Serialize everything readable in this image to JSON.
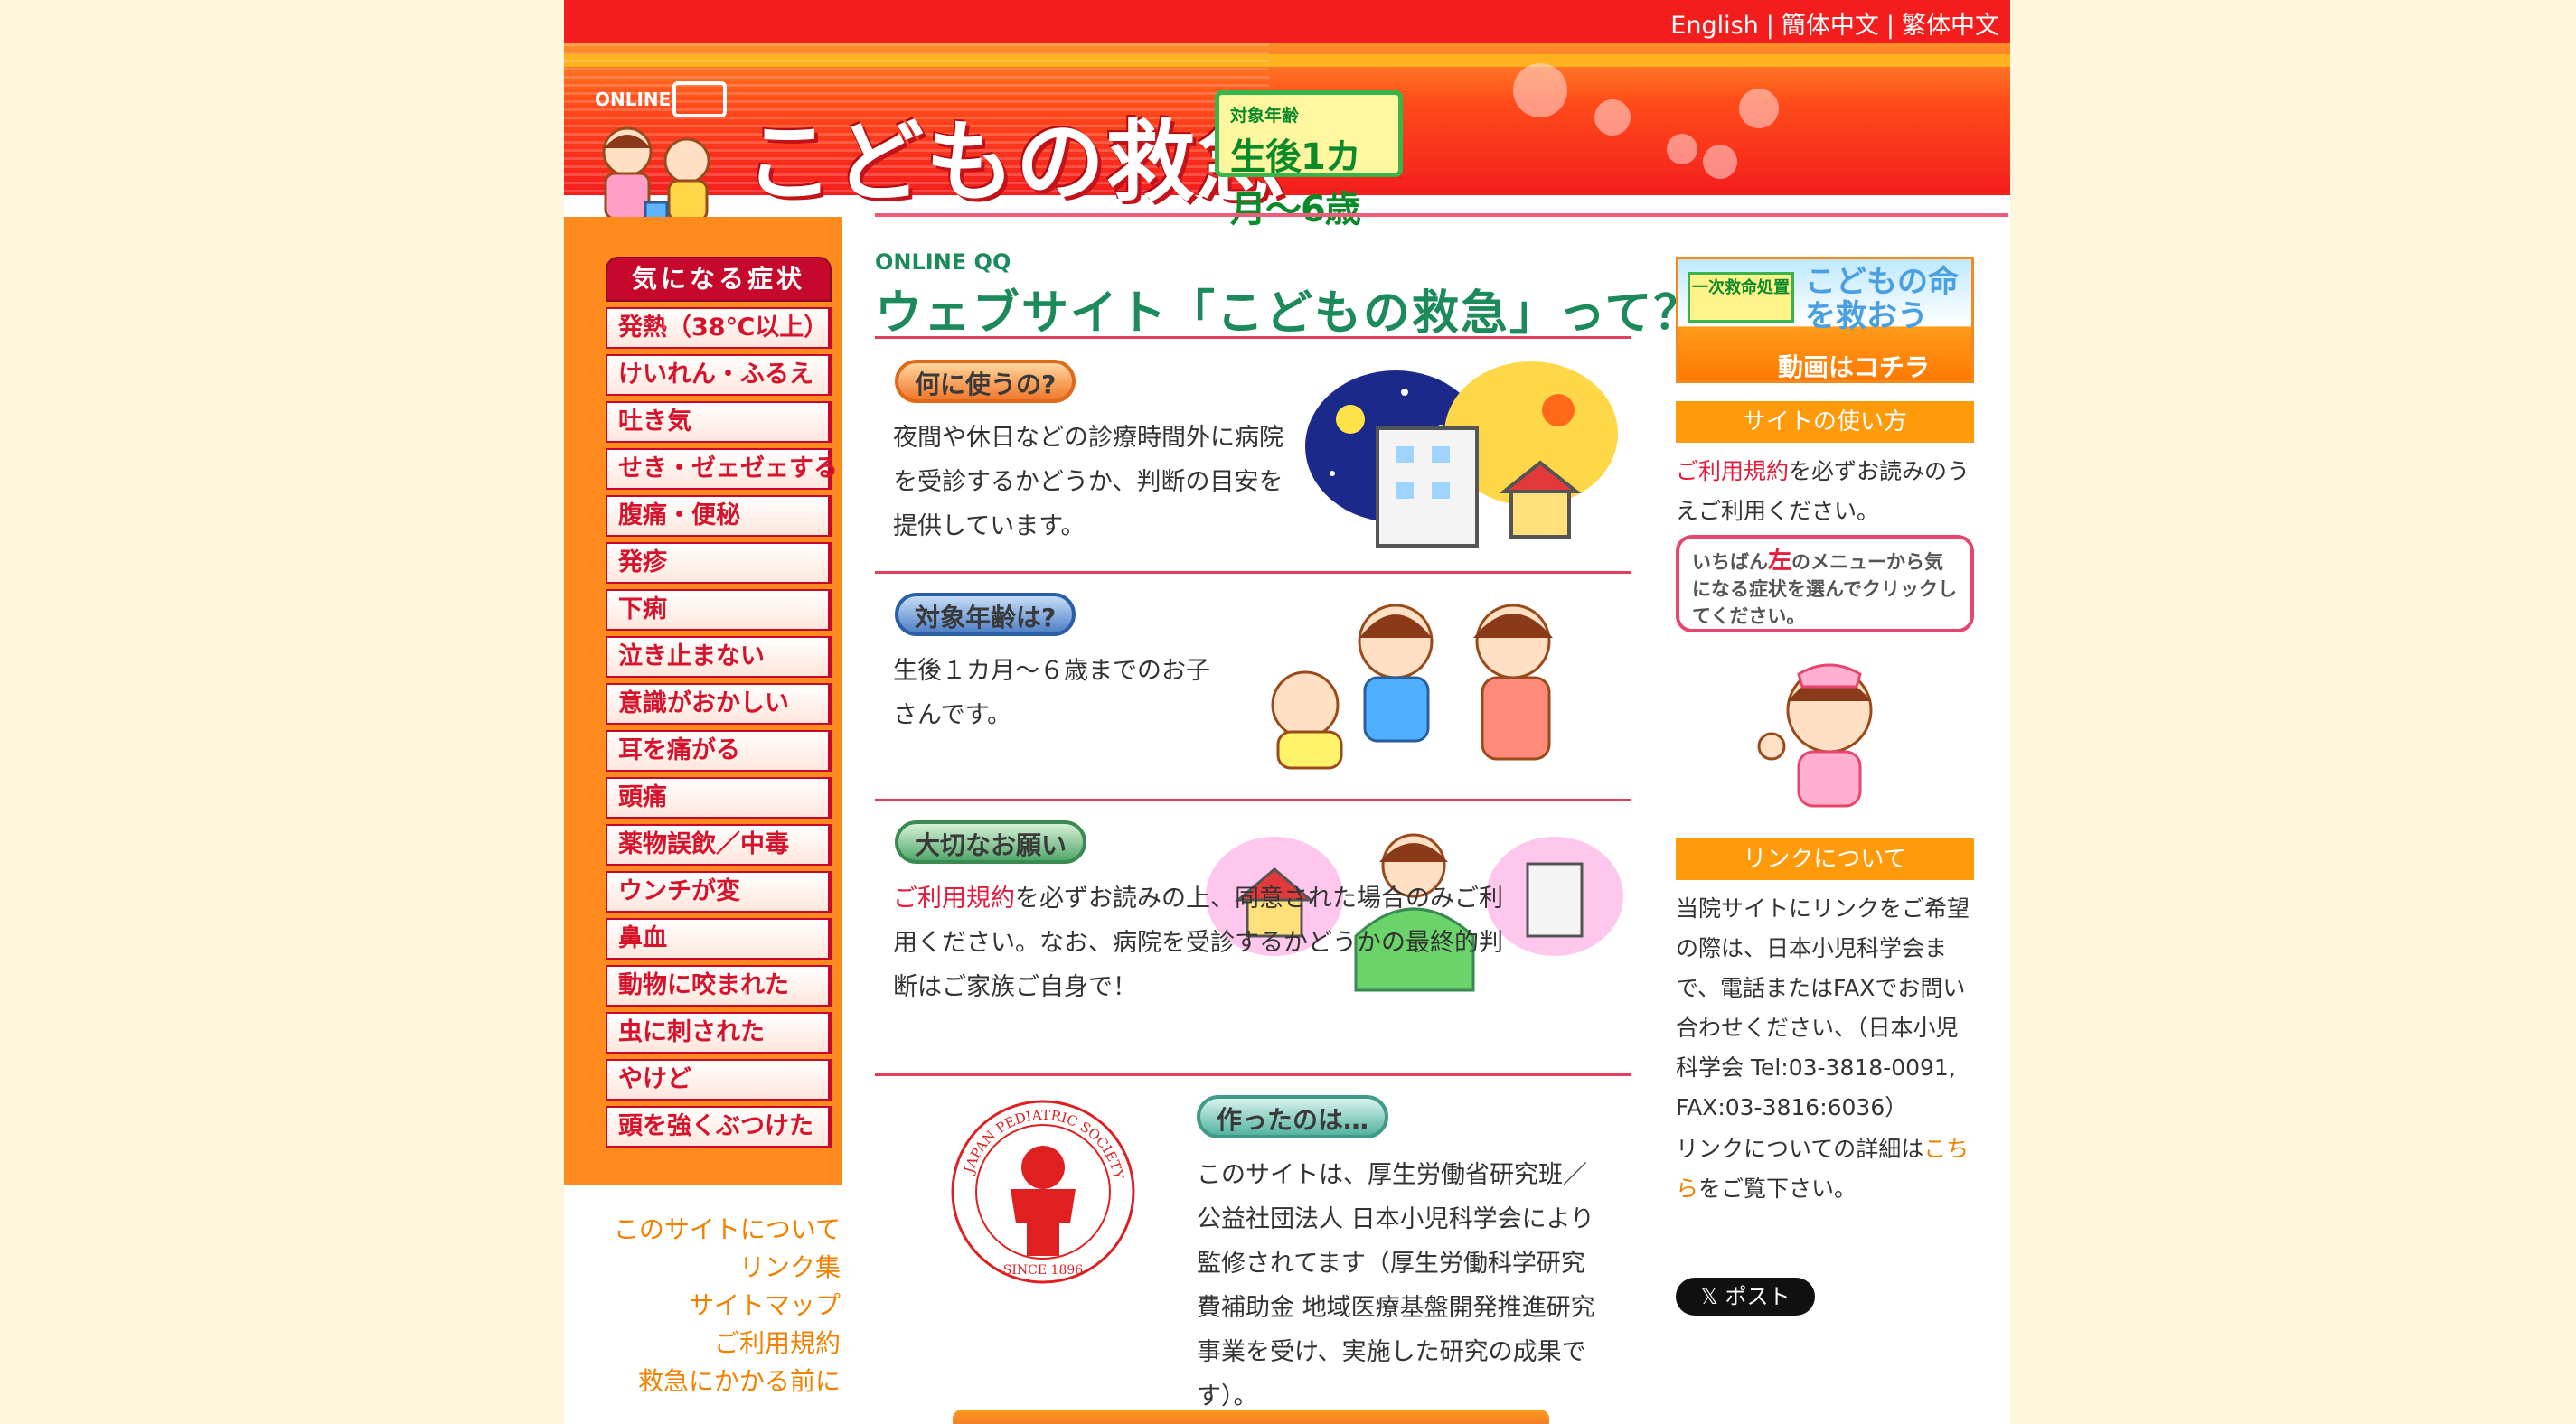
{
  "languages": [
    "English",
    "簡体中文",
    "繁体中文"
  ],
  "header": {
    "logo_online": "ONLINE",
    "site_title": "こどもの救急",
    "age_label": "対象年齢",
    "age_range": "生後1カ月〜6歳"
  },
  "symptoms": {
    "heading": "気になる症状",
    "items": [
      "発熱（38℃以上）",
      "けいれん・ふるえ",
      "吐き気",
      "せき・ゼェゼェする",
      "腹痛・便秘",
      "発疹",
      "下痢",
      "泣き止まない",
      "意識がおかしい",
      "耳を痛がる",
      "頭痛",
      "薬物誤飲／中毒",
      "ウンチが変",
      "鼻血",
      "動物に咬まれた",
      "虫に刺された",
      "やけど",
      "頭を強くぶつけた"
    ]
  },
  "footer_links": [
    "このサイトについて",
    "リンク集",
    "サイトマップ",
    "ご利用規約",
    "救急にかかる前に"
  ],
  "main": {
    "qq_label": "ONLINE QQ",
    "title": "ウェブサイト「こどもの救急」って？",
    "sections": [
      {
        "heading": "何に使うの?",
        "text": "夜間や休日などの診療時間外に病院を受診するかどうか、判断の目安を提供しています。"
      },
      {
        "heading": "対象年齢は?",
        "text": "生後１カ月〜６歳までのお子さんです。"
      },
      {
        "heading": "大切なお願い",
        "link": "ご利用規約",
        "text": "を必ずお読みの上、同意された場合のみご利用ください。なお、病院を受診するかどうかの最終的判断はご家族ご自身で！"
      },
      {
        "heading": "作ったのは…",
        "text": "このサイトは、厚生労働省研究班／公益社団法人 日本小児科学会により監修されてます（厚生労働科学研究費補助金 地域医療基盤開発推進研究事業を受け、実施した研究の成果です）。"
      }
    ],
    "society_ring_text": "JAPAN PEDIATRIC SOCIETY",
    "society_since": "SINCE 1896"
  },
  "sidebar": {
    "video_badge": "一次救命処置",
    "video_title": "こどもの命を救おう",
    "video_cta": "動画はコチラ",
    "usage_heading": "サイトの使い方",
    "usage_link": "ご利用規約",
    "usage_text": "を必ずお読みのうえご利用ください。",
    "speech_pre": "いちばん",
    "speech_em": "左",
    "speech_post": "のメニューから気になる症状を選んでクリックしてください。",
    "link_heading": "リンクについて",
    "link_text": "当院サイトにリンクをご希望の際は、日本小児科学会まで、電話またはFAXでお問い合わせください、（日本小児科学会 Tel:03-3818-0091, FAX:03-3816:6036）",
    "link_detail_pre": "リンクについての詳細は",
    "link_detail_link": "こちら",
    "link_detail_post": "をご覧下さい。",
    "x_post": "𝕏 ポスト"
  },
  "colors": {
    "header_red": "#f41d1d",
    "menu_red": "#c6082d",
    "left_orange": "#ff8b1e",
    "title_green": "#1c8a5a",
    "page_bg": "#fff6dc"
  }
}
